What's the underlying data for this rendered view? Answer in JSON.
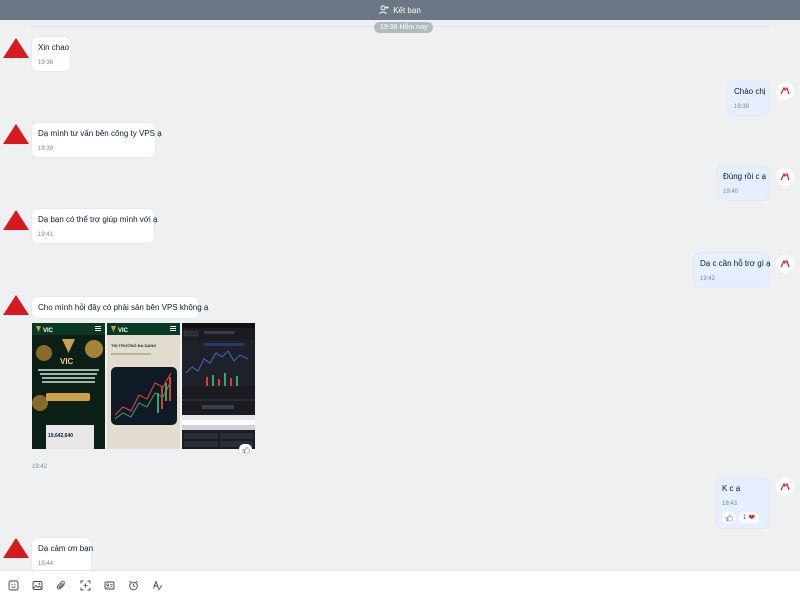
{
  "header": {
    "title": "Kết bạn",
    "icon": "add-friend-icon",
    "bg_color": "#6b7784"
  },
  "date_separator": "19:36 Hôm nay",
  "colors": {
    "own_bubble": "#e5efff",
    "other_bubble": "#ffffff",
    "avatar_red": "#d71920",
    "heart": "#e0242e"
  },
  "messages": [
    {
      "side": "left",
      "text": "Xin chao",
      "time": "19:38"
    },
    {
      "side": "right",
      "text": "Chào chị",
      "time": "19:39"
    },
    {
      "side": "left",
      "text": "Dạ mình tư vấn bên công ty VPS ạ",
      "time": "19:39"
    },
    {
      "side": "right",
      "text": "Đúng rồi c ạ",
      "time": "19:40"
    },
    {
      "side": "left",
      "text": "Dạ bạn có thể trợ giúp mình với ạ",
      "time": "19:41"
    },
    {
      "side": "right",
      "text": "Dạ c cần hỗ trợ gì ạ",
      "time": "19:42"
    },
    {
      "side": "left",
      "text": "Cho mình hỏi đây có phải sản bên VPS không ạ",
      "time": ""
    },
    {
      "side": "right",
      "text": "K c ạ",
      "time": "19:43",
      "reaction_count": "1"
    },
    {
      "side": "left",
      "text": "Dạ cảm ơn bạn",
      "time": "19:44"
    }
  ],
  "image_group": {
    "time": "19:42",
    "screens": [
      {
        "logo": "VIC",
        "headline": "VIC",
        "value": "19,642,640"
      },
      {
        "logo": "VIC",
        "headline": "THỊ TRƯỜNG ĐA DẠNG"
      },
      {
        "headline": ""
      }
    ]
  },
  "toolbar": {
    "icons": [
      "sticker-icon",
      "image-icon",
      "attachment-icon",
      "screenshot-icon",
      "card-icon",
      "reminder-icon",
      "format-text-icon"
    ]
  }
}
